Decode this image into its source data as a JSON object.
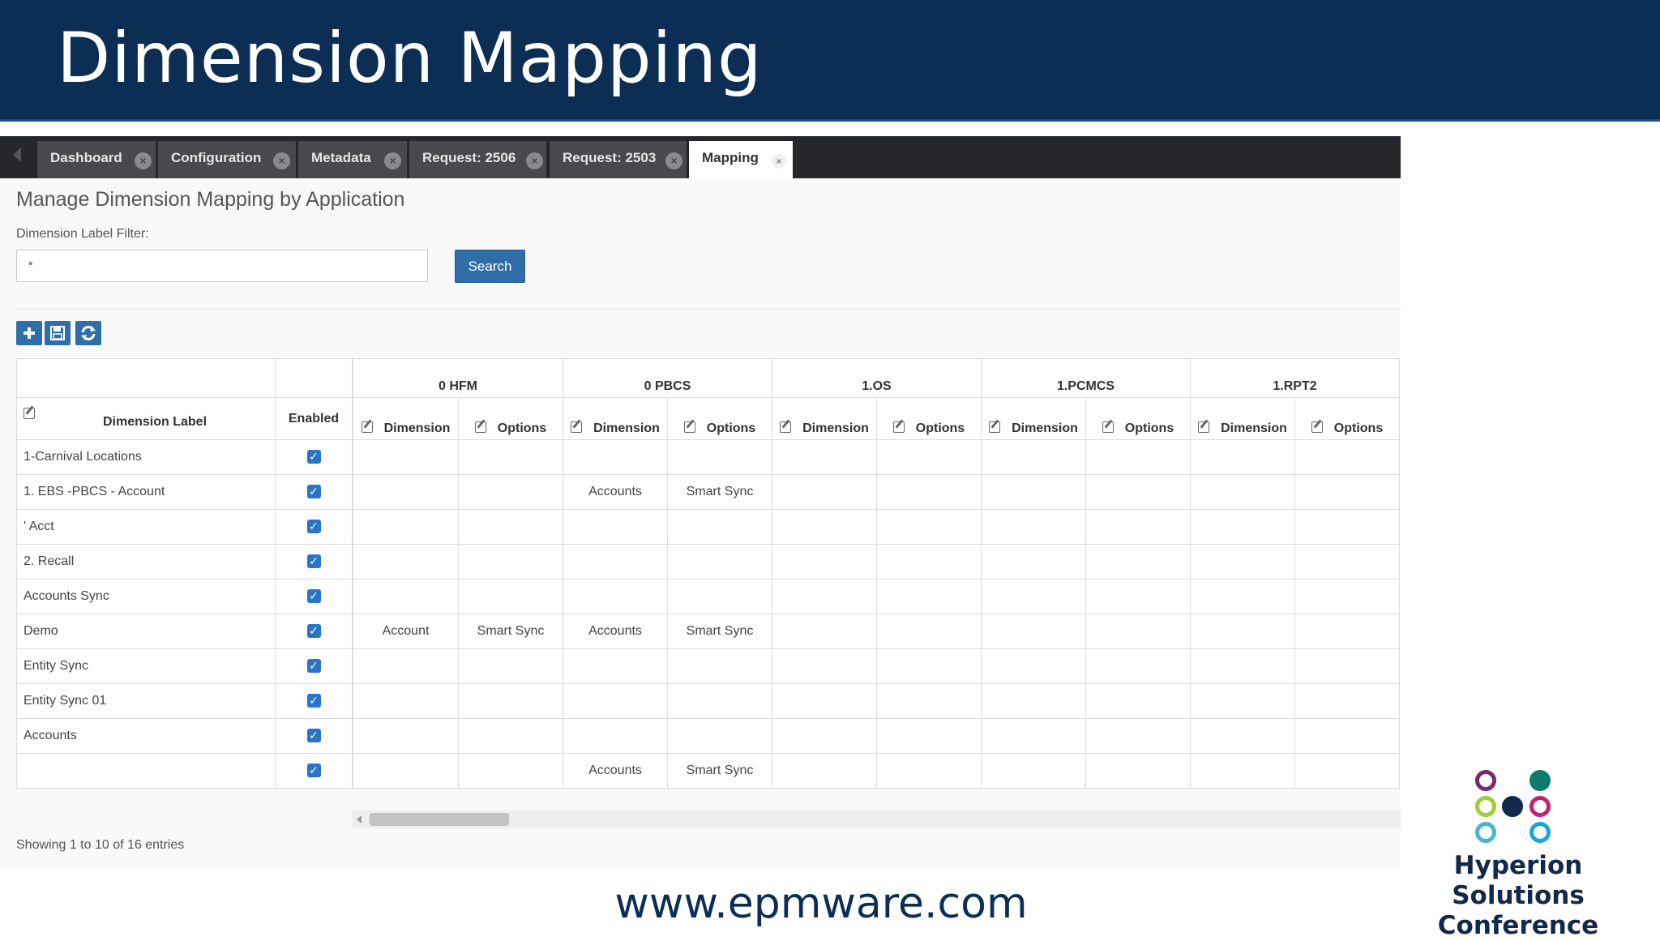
{
  "slide": {
    "title": "Dimension Mapping",
    "footer_url": "www.epmware.com",
    "logo_line1": "Hyperion Solutions",
    "logo_line2": "Conference"
  },
  "tabs": [
    {
      "label": "Dashboard",
      "active": false
    },
    {
      "label": "Configuration",
      "active": false
    },
    {
      "label": "Metadata",
      "active": false
    },
    {
      "label": "Request: 2506",
      "active": false
    },
    {
      "label": "Request: 2503",
      "active": false
    },
    {
      "label": "Mapping",
      "active": true
    }
  ],
  "page": {
    "title": "Manage Dimension Mapping by Application",
    "filter_label": "Dimension Label Filter:",
    "filter_value": "*",
    "search_label": "Search",
    "toolbar_icons": [
      "add-icon",
      "save-icon",
      "refresh-icon"
    ]
  },
  "grid": {
    "col_label": "Dimension Label",
    "col_enabled": "Enabled",
    "sub_dimension": "Dimension",
    "sub_options": "Options",
    "applications": [
      "0 HFM",
      "0 PBCS",
      "1.OS",
      "1.PCMCS",
      "1.RPT2"
    ],
    "rows": [
      {
        "label": "1-Carnival Locations",
        "enabled": true,
        "cells": [
          "",
          "",
          "",
          "",
          "",
          "",
          "",
          "",
          "",
          ""
        ]
      },
      {
        "label": "1. EBS -PBCS - Account",
        "enabled": true,
        "cells": [
          "",
          "",
          "Accounts",
          "Smart Sync",
          "",
          "",
          "",
          "",
          "",
          ""
        ]
      },
      {
        "label": "' Acct",
        "enabled": true,
        "cells": [
          "",
          "",
          "",
          "",
          "",
          "",
          "",
          "",
          "",
          ""
        ]
      },
      {
        "label": "2. Recall",
        "enabled": true,
        "cells": [
          "",
          "",
          "",
          "",
          "",
          "",
          "",
          "",
          "",
          ""
        ]
      },
      {
        "label": "Accounts Sync",
        "enabled": true,
        "cells": [
          "",
          "",
          "",
          "",
          "",
          "",
          "",
          "",
          "",
          ""
        ]
      },
      {
        "label": "Demo",
        "enabled": true,
        "cells": [
          "Account",
          "Smart Sync",
          "Accounts",
          "Smart Sync",
          "",
          "",
          "",
          "",
          "",
          ""
        ]
      },
      {
        "label": "Entity Sync",
        "enabled": true,
        "cells": [
          "",
          "",
          "",
          "",
          "",
          "",
          "",
          "",
          "",
          ""
        ]
      },
      {
        "label": "Entity Sync 01",
        "enabled": true,
        "cells": [
          "",
          "",
          "",
          "",
          "",
          "",
          "",
          "",
          "",
          ""
        ]
      },
      {
        "label": "Accounts",
        "enabled": true,
        "cells": [
          "",
          "",
          "",
          "",
          "",
          "",
          "",
          "",
          "",
          ""
        ]
      },
      {
        "label": "",
        "enabled": true,
        "cells": [
          "",
          "",
          "Accounts",
          "Smart Sync",
          "",
          "",
          "",
          "",
          "",
          ""
        ]
      }
    ],
    "showing_text": "Showing 1 to 10 of 16 entries"
  },
  "colors": {
    "banner": "#0c2e54",
    "primary_button": "#2f6ea8",
    "checkbox": "#2a74c8",
    "tabbar": "#26272b"
  }
}
